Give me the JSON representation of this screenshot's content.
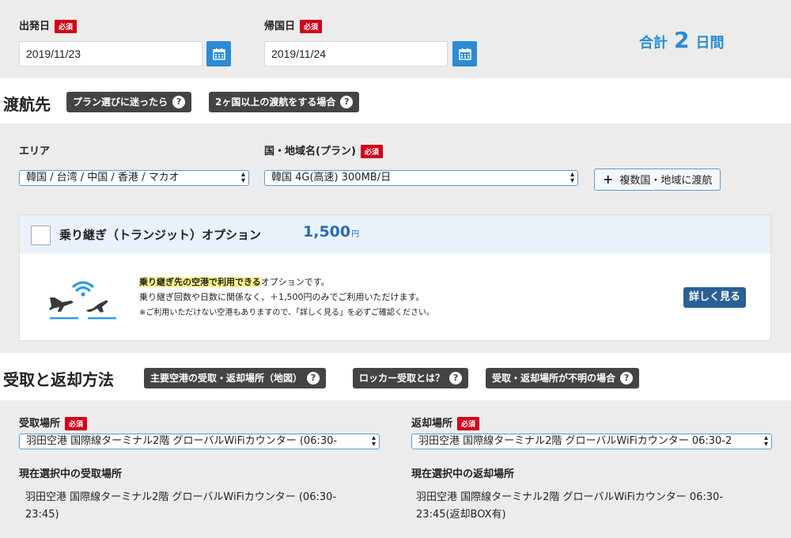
{
  "dates": {
    "departure_label": "出発日",
    "return_label": "帰国日",
    "required": "必須",
    "departure_value": "2019/11/23",
    "return_value": "2019/11/24",
    "total_prefix": "合計",
    "total_days": "2",
    "total_suffix": "日間"
  },
  "destination": {
    "title": "渡航先",
    "help_plan": "プラン選びに迷ったら",
    "help_multi": "2ヶ国以上の渡航をする場合",
    "area_label": "エリア",
    "country_label": "国・地域名(プラン)",
    "required": "必須",
    "area_value": "韓国 / 台湾 / 中国 / 香港 / マカオ",
    "country_value": "韓国 4G(高速) 300MB/日",
    "multi_button": "複数国・地域に渡航"
  },
  "transit": {
    "title": "乗り継ぎ（トランジット）オプション",
    "price": "1,500",
    "price_unit": "円",
    "desc_highlight": "乗り継ぎ先の空港で利用できる",
    "desc_rest": "オプションです。",
    "desc_line2": "乗り継ぎ回数や日数に関係なく、＋1,500円のみでご利用いただけます。",
    "desc_line3": "※ご利用いただけない空港もありますので、「詳しく見る」を必ずご確認ください。",
    "detail_button": "詳しく見る"
  },
  "pickup": {
    "title": "受取と返却方法",
    "help_map": "主要空港の受取・返却場所（地図）",
    "help_locker": "ロッカー受取とは？",
    "help_unknown": "受取・返却場所が不明の場合",
    "pickup_label": "受取場所",
    "return_label": "返却場所",
    "required": "必須",
    "pickup_value": "羽田空港 国際線ターミナル2階 グローバルWiFiカウンター (06:30-",
    "return_value": "羽田空港 国際線ターミナル2階 グローバルWiFiカウンター 06:30-2",
    "current_pickup_label": "現在選択中の受取場所",
    "current_return_label": "現在選択中の返却場所",
    "current_pickup_line1": "羽田空港 国際線ターミナル2階 グローバルWiFiカウンター (06:30-",
    "current_pickup_line2": "23:45)",
    "current_return_line1": "羽田空港 国際線ターミナル2階 グローバルWiFiカウンター 06:30-",
    "current_return_line2": "23:45(返却BOX有)"
  },
  "icons": {
    "calendar": "calendar-icon",
    "question": "question-icon",
    "plus": "plus-icon",
    "select_arrow": "select-arrow-icon",
    "transit": "airplane-wifi-icon"
  },
  "colors": {
    "accent_blue": "#2b8bd6",
    "required_red": "#d0021b",
    "help_dark": "#444444",
    "detail_button": "#2b5f97"
  }
}
